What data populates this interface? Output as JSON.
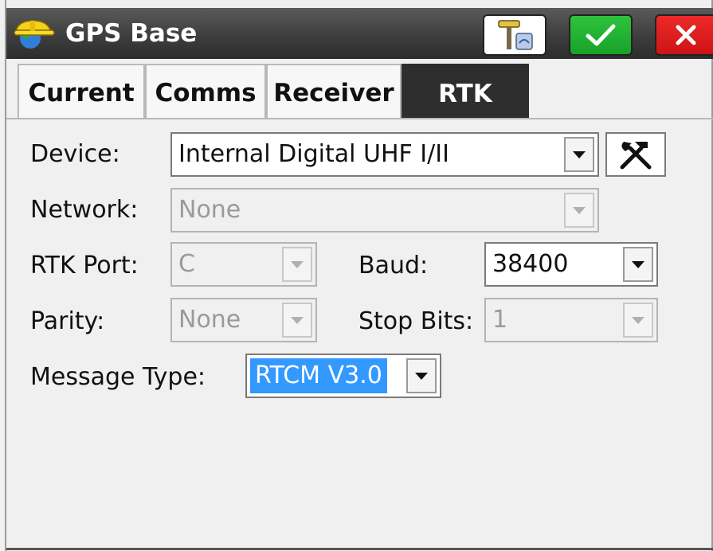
{
  "window": {
    "title": "GPS Base",
    "app_icon": "hardhat-globe-icon",
    "buttons": {
      "gps_icon": "gps-receiver-icon",
      "ok_icon": "checkmark-icon",
      "close_icon": "close-icon"
    }
  },
  "tabs": [
    {
      "label": "Current",
      "active": false
    },
    {
      "label": "Comms",
      "active": false
    },
    {
      "label": "Receiver",
      "active": false
    },
    {
      "label": "RTK",
      "active": true
    }
  ],
  "form": {
    "device": {
      "label": "Device:",
      "value": "Internal Digital UHF I/II",
      "enabled": true
    },
    "network": {
      "label": "Network:",
      "value": "None",
      "enabled": false
    },
    "rtk_port": {
      "label": "RTK Port:",
      "value": "C",
      "enabled": false
    },
    "baud": {
      "label": "Baud:",
      "value": "38400",
      "enabled": true
    },
    "parity": {
      "label": "Parity:",
      "value": "None",
      "enabled": false
    },
    "stop_bits": {
      "label": "Stop Bits:",
      "value": "1",
      "enabled": false
    },
    "message_type": {
      "label": "Message Type:",
      "value": "RTCM V3.0",
      "enabled": true,
      "highlighted": true
    },
    "config_button_icon": "hammer-wrench-icon"
  },
  "colors": {
    "selection": "#3399ff",
    "ok_green": "#1fb030",
    "close_red": "#dd1c1c",
    "titlebar": "#3e3e3e"
  }
}
